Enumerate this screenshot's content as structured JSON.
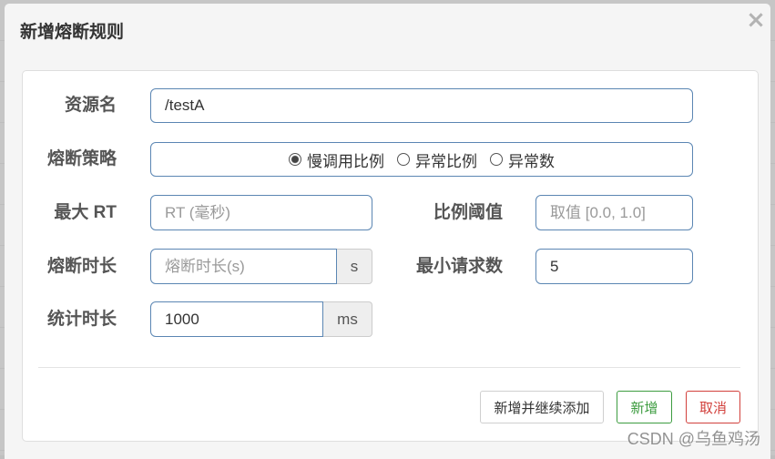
{
  "modal": {
    "title": "新增熔断规则",
    "close_label": "×"
  },
  "form": {
    "resource": {
      "label": "资源名",
      "value": "/testA"
    },
    "strategy": {
      "label": "熔断策略",
      "options": [
        {
          "label": "慢调用比例",
          "selected": true
        },
        {
          "label": "异常比例",
          "selected": false
        },
        {
          "label": "异常数",
          "selected": false
        }
      ]
    },
    "max_rt": {
      "label": "最大 RT",
      "value": "",
      "placeholder": "RT (毫秒)"
    },
    "ratio_threshold": {
      "label": "比例阈值",
      "value": "",
      "placeholder": "取值 [0.0, 1.0]"
    },
    "break_duration": {
      "label": "熔断时长",
      "value": "",
      "placeholder": "熔断时长(s)",
      "unit": "s"
    },
    "min_request": {
      "label": "最小请求数",
      "value": "5"
    },
    "stat_duration": {
      "label": "统计时长",
      "value": "1000",
      "unit": "ms"
    }
  },
  "footer": {
    "add_continue_label": "新增并继续添加",
    "add_label": "新增",
    "cancel_label": "取消"
  },
  "watermark": "CSDN @乌鱼鸡汤",
  "icons": {
    "close": "close-icon",
    "radio": "radio-icon"
  },
  "colors": {
    "input_border": "#5b86b3",
    "success": "#3d9c40",
    "danger": "#d2403c"
  }
}
